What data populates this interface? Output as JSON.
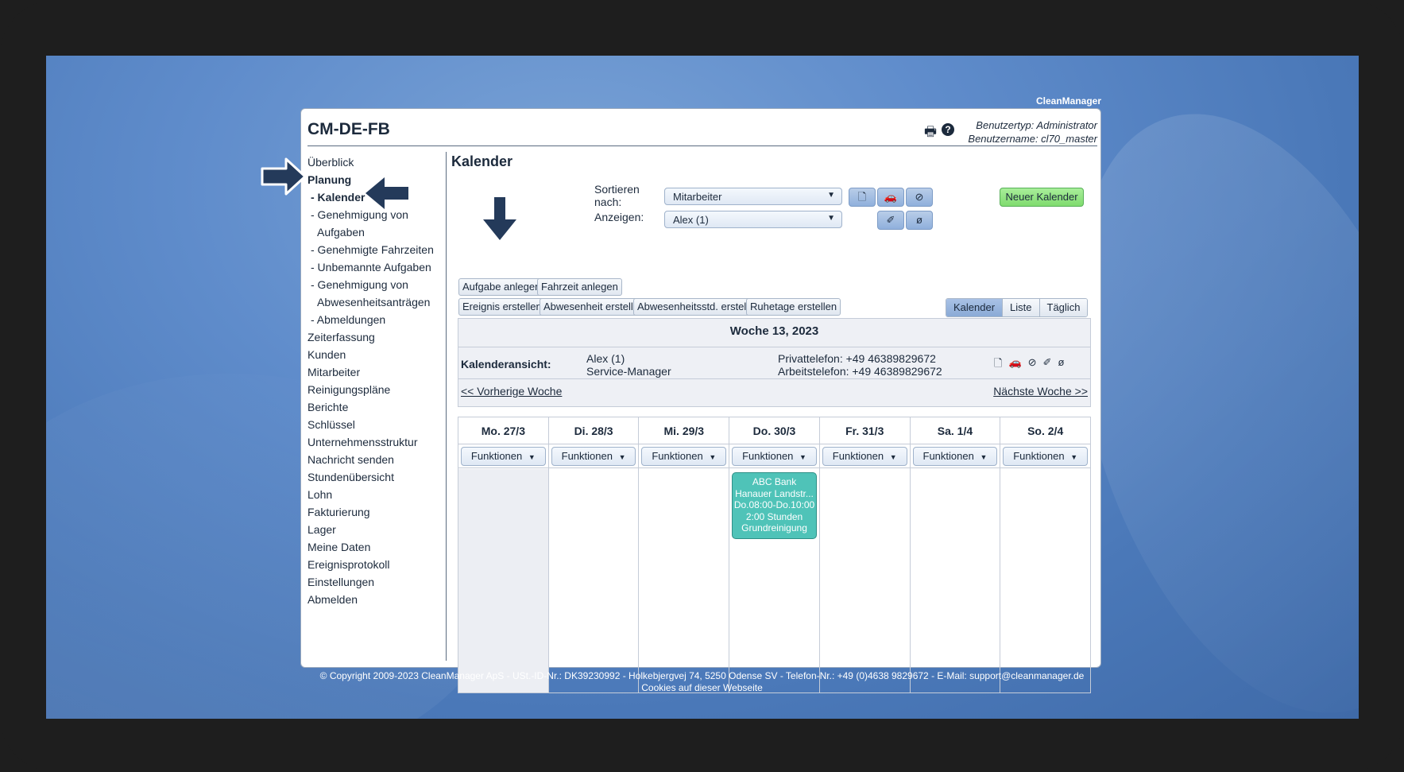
{
  "brand": "CleanManager",
  "app": {
    "title": "CM-DE-FB",
    "user_type": "Benutzertyp: Administrator",
    "user_name": "Benutzername: cl70_master",
    "icons": [
      "print-icon",
      "help-icon"
    ]
  },
  "sidebar": {
    "items": [
      {
        "label": "Überblick"
      },
      {
        "label": "Planung"
      },
      {
        "label": "- Kalender"
      },
      {
        "label": "- Genehmigung von"
      },
      {
        "label": "Aufgaben"
      },
      {
        "label": "- Genehmigte Fahrzeiten"
      },
      {
        "label": "- Unbemannte Aufgaben"
      },
      {
        "label": "- Genehmigung von"
      },
      {
        "label": "Abwesenheitsanträgen"
      },
      {
        "label": "- Abmeldungen"
      },
      {
        "label": "Zeiterfassung"
      },
      {
        "label": "Kunden"
      },
      {
        "label": "Mitarbeiter"
      },
      {
        "label": "Reinigungspläne"
      },
      {
        "label": "Berichte"
      },
      {
        "label": "Schlüssel"
      },
      {
        "label": "Unternehmensstruktur"
      },
      {
        "label": "Nachricht senden"
      },
      {
        "label": "Stundenübersicht"
      },
      {
        "label": "Lohn"
      },
      {
        "label": "Fakturierung"
      },
      {
        "label": "Lager"
      },
      {
        "label": "Meine Daten"
      },
      {
        "label": "Ereignisprotokoll"
      },
      {
        "label": "Einstellungen"
      },
      {
        "label": "Abmelden"
      }
    ]
  },
  "main": {
    "title": "Kalender",
    "sort_label_1": "Sortieren",
    "sort_label_2": "nach:",
    "show_label": "Anzeigen:",
    "sort_value": "Mitarbeiter",
    "show_value": "Alex (1)",
    "new_calendar": "Neuer Kalender",
    "buttons_row1": {
      "task": "Aufgabe anlegen",
      "drive": "Fahrzeit anlegen"
    },
    "buttons_row2": {
      "event": "Ereignis erstellen",
      "absence": "Abwesenheit erstellen",
      "absence_hours": "Abwesenheitsstd. erstellen",
      "rest_days": "Ruhetage erstellen"
    },
    "views": {
      "calendar": "Kalender",
      "list": "Liste",
      "daily": "Täglich"
    },
    "week_title": "Woche 13, 2023",
    "calendar_view_label": "Kalenderansicht:",
    "employee_name": "Alex (1)",
    "employee_role": "Service-Manager",
    "private_phone": "Privattelefon: +49 46389829672",
    "work_phone": "Arbeitstelefon: +49 46389829672",
    "prev_week": "<< Vorherige Woche",
    "next_week": "Nächste Woche >>",
    "functions_label": "Funktionen",
    "days": [
      "Mo. 27/3",
      "Di. 28/3",
      "Mi. 29/3",
      "Do. 30/3",
      "Fr. 31/3",
      "Sa. 1/4",
      "So. 2/4"
    ],
    "event": {
      "line1": "ABC Bank",
      "line2": "Hanauer Landstr...",
      "line3": "Do.08:00-Do.10:00",
      "line4": "2:00 Stunden",
      "line5": "Grundreinigung"
    }
  },
  "footer": {
    "line1": "© Copyright 2009-2023 CleanManager ApS - USt.-ID-Nr.: DK39230992 - Holkebjergvej 74, 5250 Odense SV - Telefon-Nr.: +49 (0)4638 9829672 - E-Mail: support@cleanmanager.de",
    "line2": "Cookies auf dieser Webseite"
  },
  "colors": {
    "accent": "#8fb0dc",
    "event": "#4fc3b8",
    "new_button": "#7fdb6e",
    "arrow": "#243a5a"
  }
}
